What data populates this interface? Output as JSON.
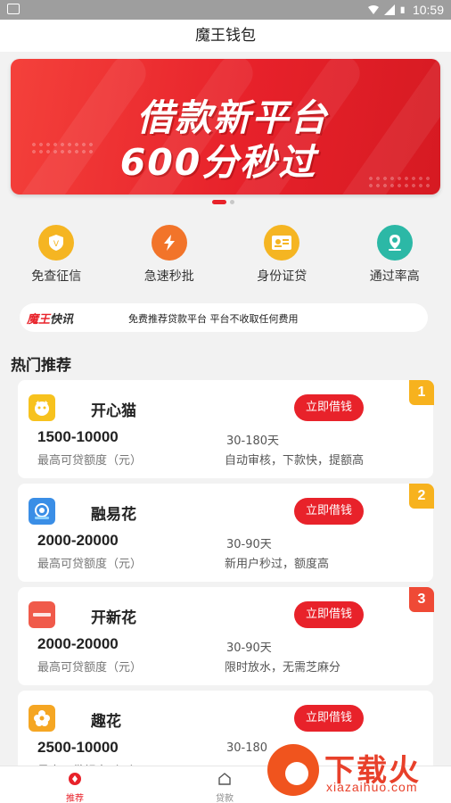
{
  "status_bar": {
    "time": "10:59"
  },
  "header": {
    "title": "魔王钱包"
  },
  "banner": {
    "line1": "借款新平台",
    "line2": "600分秒过"
  },
  "features": [
    {
      "label": "免查征信",
      "icon": "shield-icon",
      "color": "#f5b522"
    },
    {
      "label": "急速秒批",
      "icon": "lightning-icon",
      "color": "#f2742a"
    },
    {
      "label": "身份证贷",
      "icon": "id-card-icon",
      "color": "#f5b522"
    },
    {
      "label": "通过率高",
      "icon": "location-check-icon",
      "color": "#2cb8a6"
    }
  ],
  "news": {
    "logo_brand": "魔王",
    "logo_suffix": "快讯",
    "text": "免费推荐贷款平台 平台不收取任何费用"
  },
  "section_title": "热门推荐",
  "cards": [
    {
      "name": "开心猫",
      "button": "立即借钱",
      "amount": "1500-10000",
      "term": "30-180天",
      "limit_label": "最高可贷额度（元）",
      "desc": "自动审核，下款快，提额高",
      "rank": "1",
      "logo_color": "#f7c21e"
    },
    {
      "name": "融易花",
      "button": "立即借钱",
      "amount": "2000-20000",
      "term": "30-90天",
      "limit_label": "最高可贷额度（元）",
      "desc": "新用户秒过，额度高",
      "rank": "2",
      "logo_color": "#3a8ee6"
    },
    {
      "name": "开新花",
      "button": "立即借钱",
      "amount": "2000-20000",
      "term": "30-90天",
      "limit_label": "最高可贷额度（元）",
      "desc": "限时放水，无需芝麻分",
      "rank": "3",
      "logo_color": "#f05a4a"
    },
    {
      "name": "趣花",
      "button": "立即借钱",
      "amount": "2500-10000",
      "term": "30-180",
      "limit_label": "最高可贷额度（元）",
      "desc": "",
      "rank": "",
      "logo_color": "#f5a623"
    }
  ],
  "tabbar": [
    {
      "label": "推荐",
      "icon": "recommend-icon",
      "active": true
    },
    {
      "label": "贷款",
      "icon": "home-icon",
      "active": false
    }
  ],
  "watermark": {
    "title": "下载火",
    "url": "xiazaihuo.com"
  },
  "colors": {
    "accent": "#e8222a",
    "rank_gold": "#f7b21e"
  }
}
